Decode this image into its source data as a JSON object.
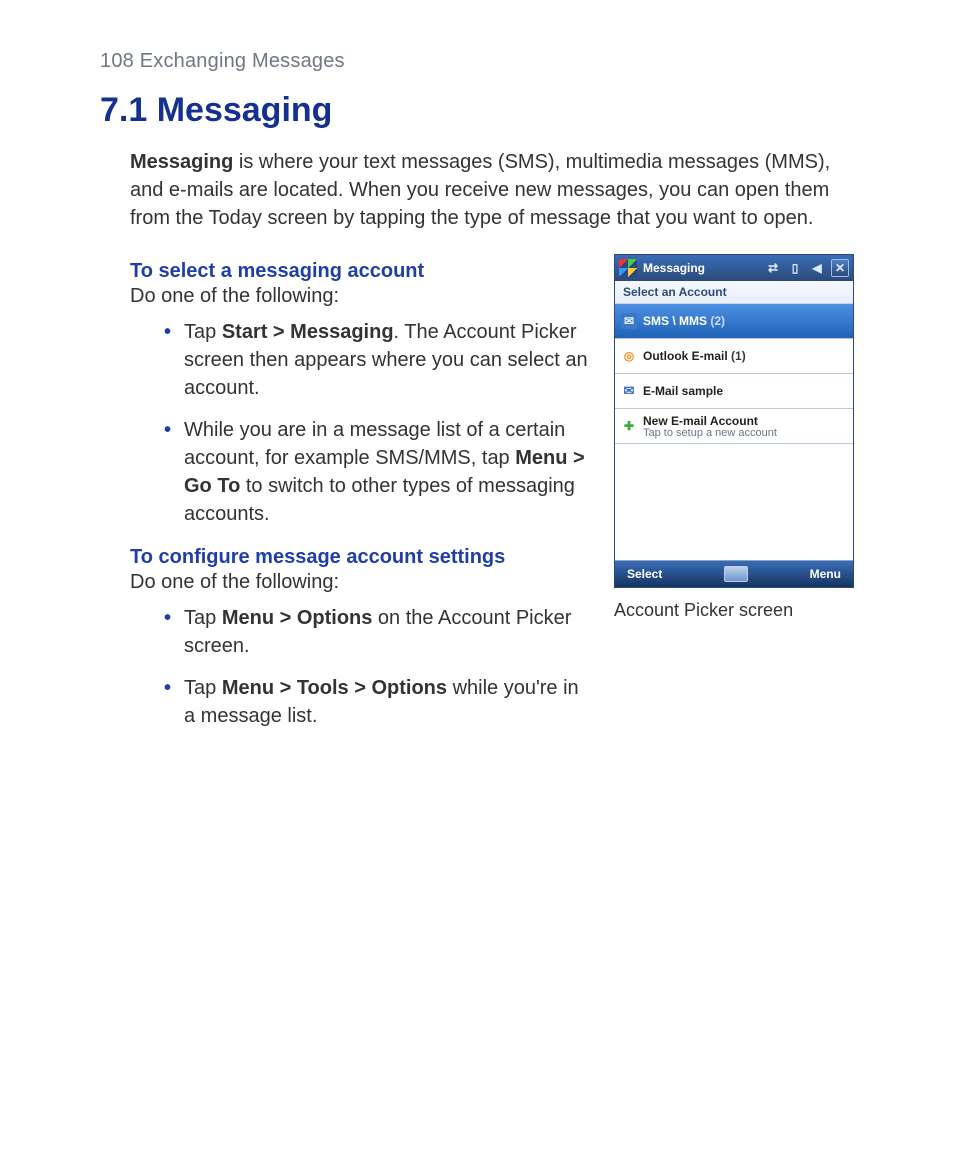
{
  "page": {
    "running_head": "108  Exchanging Messages",
    "section_title": "7.1  Messaging"
  },
  "intro": {
    "lead_bold": "Messaging",
    "rest": " is where your text messages (SMS), multimedia messages (MMS), and e-mails are located. When you receive new messages, you can open them from the Today screen by tapping the type of message that you want to open."
  },
  "section1": {
    "subhead": "To select a messaging account",
    "lead": "Do one of the following:",
    "items": [
      {
        "pre": "Tap ",
        "bold": "Start > Messaging",
        "post": ". The Account Picker screen then appears where you can select an account."
      },
      {
        "pre": "While you are in a message list of a certain account, for example SMS/MMS, tap ",
        "bold": "Menu > Go To",
        "post": " to switch to other types of messaging accounts."
      }
    ]
  },
  "section2": {
    "subhead": "To configure message account settings",
    "lead": "Do one of the following:",
    "items": [
      {
        "pre": "Tap ",
        "bold": "Menu > Options",
        "post": " on the Account Picker screen."
      },
      {
        "pre": "Tap ",
        "bold": "Menu > Tools > Options",
        "post": " while you're in a message list."
      }
    ]
  },
  "device": {
    "titlebar": {
      "title": "Messaging",
      "icons": {
        "connect": "⇄",
        "signal": "▯",
        "volume": "◀",
        "close": "✕"
      }
    },
    "subbar": "Select an Account",
    "rows": [
      {
        "icon": "sms",
        "label": "SMS \\ MMS",
        "count": "(2)",
        "selected": true
      },
      {
        "icon": "outlook",
        "label": "Outlook E-mail",
        "count": "(1)",
        "selected": false
      },
      {
        "icon": "mail",
        "label": "E-Mail sample",
        "count": "",
        "selected": false
      },
      {
        "icon": "new",
        "label": "New E-mail Account",
        "sub": "Tap to setup a new account",
        "selected": false
      }
    ],
    "bottombar": {
      "left": "Select",
      "right": "Menu"
    },
    "caption": "Account Picker screen"
  }
}
